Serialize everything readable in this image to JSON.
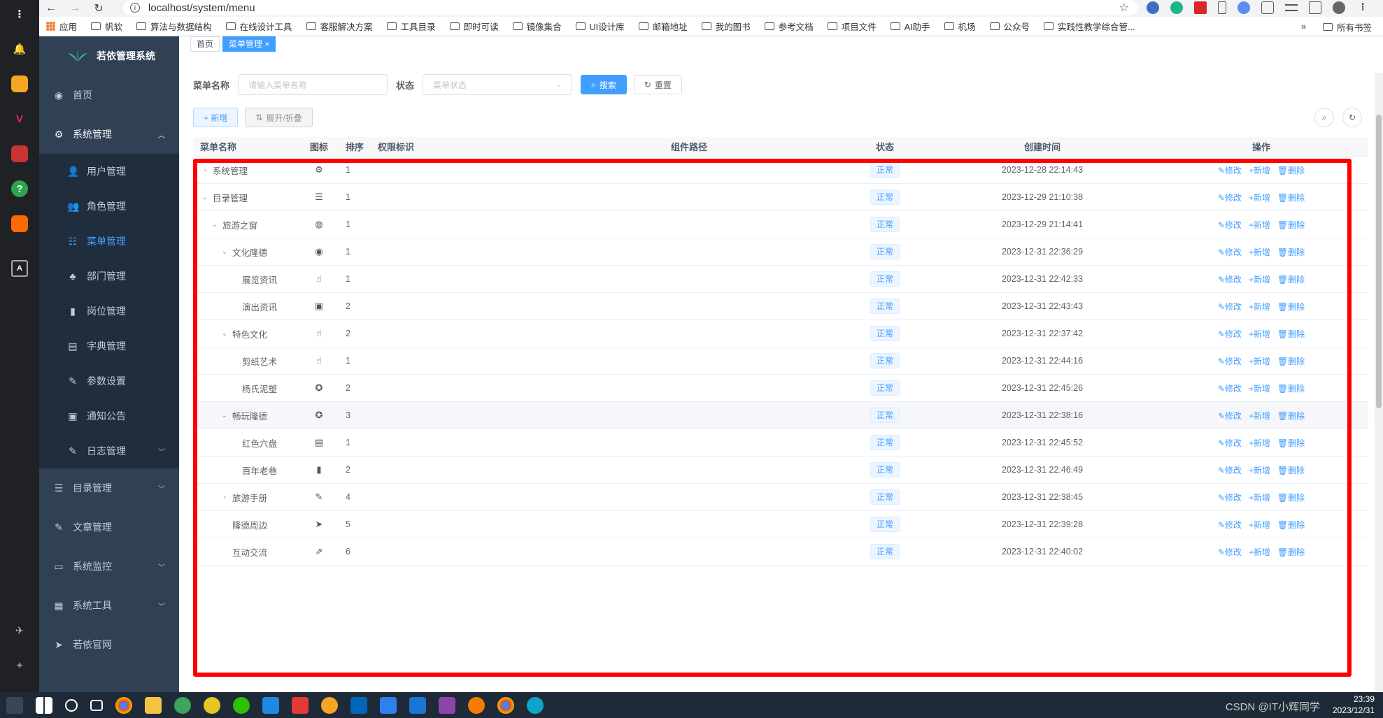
{
  "browser": {
    "url": "localhost/system/menu",
    "bookmarks": [
      "应用",
      "帆软",
      "算法与数据结构",
      "在线设计工具",
      "客服解决方案",
      "工具目录",
      "即时可读",
      "镜像集合",
      "UI设计库",
      "邮箱地址",
      "我的图书",
      "参考文档",
      "项目文件",
      "AI助手",
      "机场",
      "公众号",
      "实践性教学综合管..."
    ],
    "all_bookmarks": "所有书签",
    "more": "»"
  },
  "app": {
    "title": "若依管理系统"
  },
  "sidebar": {
    "items": [
      {
        "label": "首页",
        "icon": "dashboard-icon"
      },
      {
        "label": "系统管理",
        "icon": "gear-icon",
        "expanded": true,
        "children": [
          {
            "label": "用户管理",
            "icon": "user-icon"
          },
          {
            "label": "角色管理",
            "icon": "peoples-icon"
          },
          {
            "label": "菜单管理",
            "icon": "tree-table-icon",
            "active": true
          },
          {
            "label": "部门管理",
            "icon": "tree-icon"
          },
          {
            "label": "岗位管理",
            "icon": "post-icon"
          },
          {
            "label": "字典管理",
            "icon": "dict-icon"
          },
          {
            "label": "参数设置",
            "icon": "edit-icon"
          },
          {
            "label": "通知公告",
            "icon": "message-icon"
          },
          {
            "label": "日志管理",
            "icon": "log-icon"
          }
        ]
      },
      {
        "label": "目录管理",
        "icon": "list-icon"
      },
      {
        "label": "文章管理",
        "icon": "edit-icon"
      },
      {
        "label": "系统监控",
        "icon": "monitor-icon"
      },
      {
        "label": "系统工具",
        "icon": "tool-icon"
      },
      {
        "label": "若依官网",
        "icon": "guide-icon"
      }
    ]
  },
  "tags": [
    {
      "label": "首页"
    },
    {
      "label": "菜单管理 ×",
      "active": true
    }
  ],
  "search": {
    "name_label": "菜单名称",
    "name_placeholder": "请输入菜单名称",
    "status_label": "状态",
    "status_placeholder": "菜单状态",
    "search_btn": "搜索",
    "reset_btn": "重置"
  },
  "toolbar": {
    "add_btn": "+ 新增",
    "expand_btn": "展开/折叠"
  },
  "table": {
    "columns": [
      "菜单名称",
      "图标",
      "排序",
      "权限标识",
      "组件路径",
      "状态",
      "创建时间",
      "操作"
    ],
    "ops": [
      "修改",
      "+新增",
      "删除"
    ],
    "rows": [
      {
        "name": "系统管理",
        "level": 0,
        "arrow": "›",
        "icon": "⚙",
        "icon_name": "system-icon",
        "sort": "1",
        "status": "正常",
        "time": "2023-12-28 22:14:43"
      },
      {
        "name": "目录管理",
        "level": 0,
        "arrow": "⌄",
        "icon": "☰",
        "icon_name": "list-icon",
        "sort": "1",
        "status": "正常",
        "time": "2023-12-29 21:10:38"
      },
      {
        "name": "旅游之窗",
        "level": 1,
        "arrow": "⌄",
        "icon": "◍",
        "icon_name": "international-icon",
        "sort": "1",
        "status": "正常",
        "time": "2023-12-29 21:14:41"
      },
      {
        "name": "文化隆德",
        "level": 2,
        "arrow": "⌄",
        "icon": "◉",
        "icon_name": "dashboard-icon",
        "sort": "1",
        "status": "正常",
        "time": "2023-12-31 22:36:29"
      },
      {
        "name": "展览资讯",
        "level": 3,
        "arrow": "",
        "icon": "☝",
        "icon_name": "thumbs-up-icon",
        "sort": "1",
        "status": "正常",
        "time": "2023-12-31 22:42:33"
      },
      {
        "name": "演出资讯",
        "level": 3,
        "arrow": "",
        "icon": "▣",
        "icon_name": "message-icon",
        "sort": "2",
        "status": "正常",
        "time": "2023-12-31 22:43:43"
      },
      {
        "name": "特色文化",
        "level": 2,
        "arrow": "⌄",
        "icon": "☝",
        "icon_name": "thumbs-up-icon",
        "sort": "2",
        "status": "正常",
        "time": "2023-12-31 22:37:42"
      },
      {
        "name": "剪纸艺术",
        "level": 3,
        "arrow": "",
        "icon": "☝",
        "icon_name": "thumbs-up-icon",
        "sort": "1",
        "status": "正常",
        "time": "2023-12-31 22:44:16"
      },
      {
        "name": "杨氏泥塑",
        "level": 3,
        "arrow": "",
        "icon": "✪",
        "icon_name": "component-icon",
        "sort": "2",
        "status": "正常",
        "time": "2023-12-31 22:45:26"
      },
      {
        "name": "畅玩隆德",
        "level": 2,
        "arrow": "⌄",
        "icon": "✪",
        "icon_name": "component-icon",
        "sort": "3",
        "status": "正常",
        "time": "2023-12-31 22:38:16",
        "hover": true
      },
      {
        "name": "红色六盘",
        "level": 3,
        "arrow": "",
        "icon": "▤",
        "icon_name": "image-icon",
        "sort": "1",
        "status": "正常",
        "time": "2023-12-31 22:45:52"
      },
      {
        "name": "百年老巷",
        "level": 3,
        "arrow": "",
        "icon": "▮",
        "icon_name": "input-icon",
        "sort": "2",
        "status": "正常",
        "time": "2023-12-31 22:46:49"
      },
      {
        "name": "旅游手册",
        "level": 2,
        "arrow": "›",
        "icon": "✎",
        "icon_name": "edit-icon",
        "sort": "4",
        "status": "正常",
        "time": "2023-12-31 22:38:45"
      },
      {
        "name": "隆德周边",
        "level": 2,
        "arrow": "",
        "icon": "➤",
        "icon_name": "guide-icon",
        "sort": "5",
        "status": "正常",
        "time": "2023-12-31 22:39:28"
      },
      {
        "name": "互动交流",
        "level": 2,
        "arrow": "",
        "icon": "⇗",
        "icon_name": "link-icon",
        "sort": "6",
        "status": "正常",
        "time": "2023-12-31 22:40:02"
      }
    ]
  },
  "taskbar": {
    "time": "23:39",
    "date": "2023/12/31",
    "watermark": "CSDN @IT小辉同学"
  }
}
